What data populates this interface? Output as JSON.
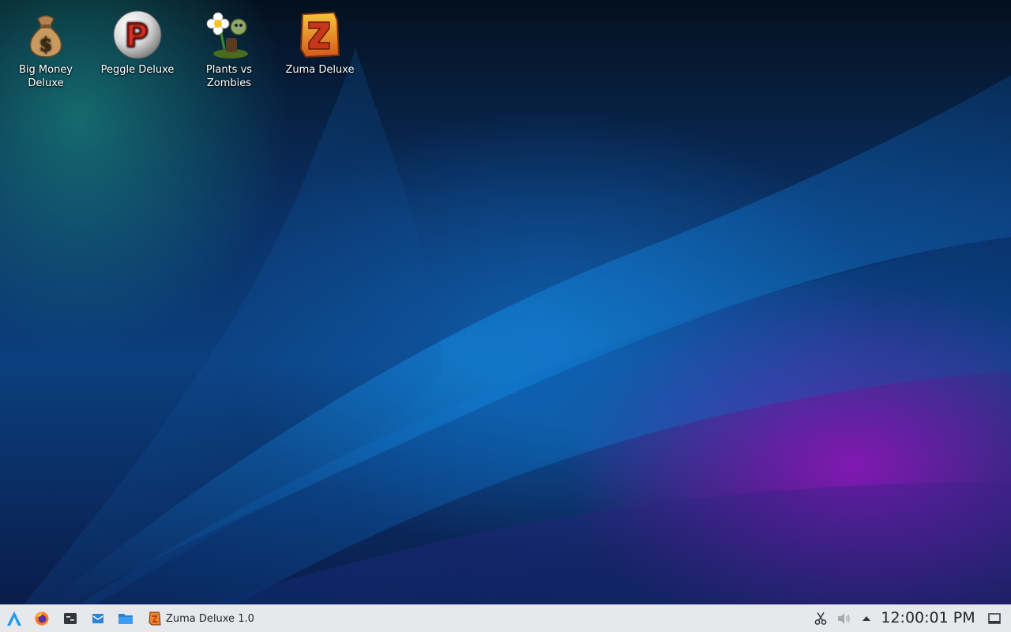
{
  "desktop": {
    "icons": [
      {
        "label_line1": "Big Money",
        "label_line2": "Deluxe",
        "icon": "money-bag-icon"
      },
      {
        "label_line1": "Peggle Deluxe",
        "label_line2": "",
        "icon": "peggle-icon"
      },
      {
        "label_line1": "Plants vs",
        "label_line2": "Zombies",
        "icon": "plants-vs-zombies-icon"
      },
      {
        "label_line1": "Zuma Deluxe",
        "label_line2": "",
        "icon": "zuma-icon"
      }
    ]
  },
  "taskbar": {
    "launchers": [
      {
        "icon": "application-launcher-icon"
      },
      {
        "icon": "firefox-icon"
      },
      {
        "icon": "terminal-icon"
      },
      {
        "icon": "email-client-icon"
      },
      {
        "icon": "file-manager-icon"
      }
    ],
    "task": {
      "label": "Zuma Deluxe 1.0",
      "icon": "zuma-icon"
    },
    "tray": {
      "clock": "12:00:01 PM",
      "icons": [
        "scissors-icon",
        "volume-icon",
        "expand-tray-icon",
        "show-desktop-icon"
      ]
    }
  },
  "colors": {
    "taskbar_bg": "#e6e8ec",
    "wallpaper_blue": "#0b3f7e",
    "wallpaper_purple": "#8a14b8",
    "accent_blue": "#1d99f3"
  }
}
